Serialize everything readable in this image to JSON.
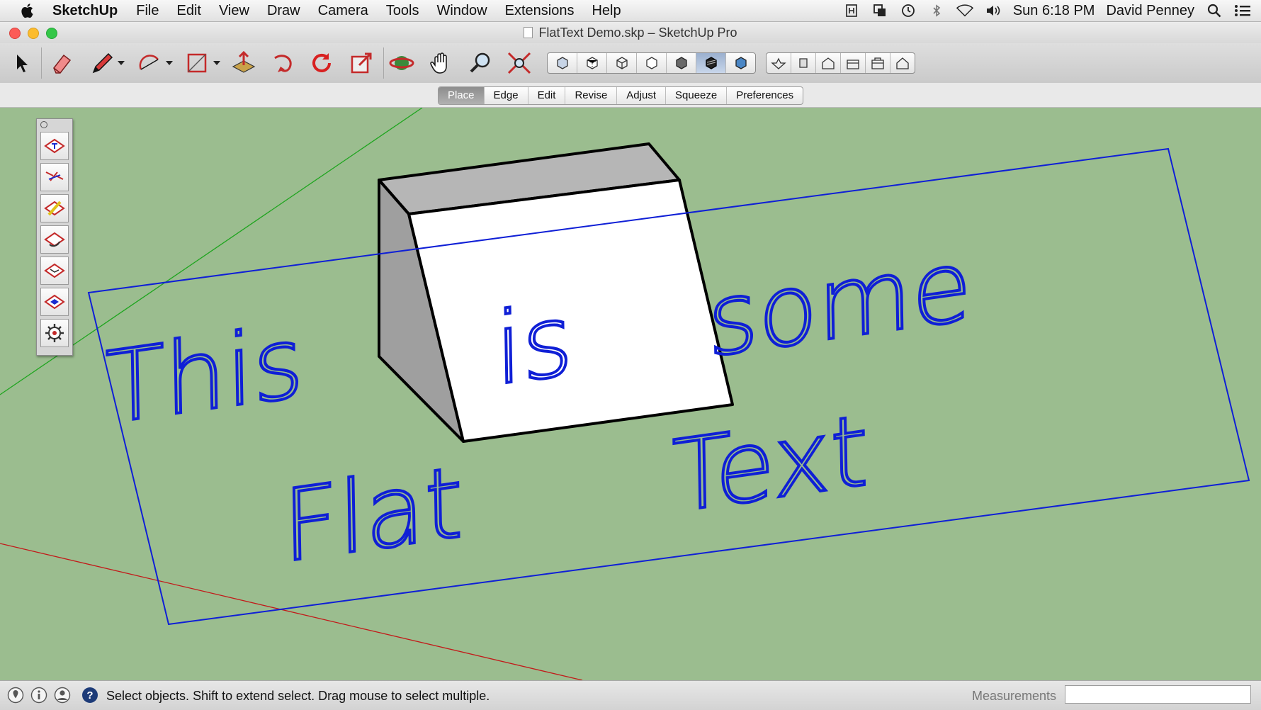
{
  "menubar": {
    "app_name": "SketchUp",
    "items": [
      "File",
      "Edit",
      "View",
      "Draw",
      "Camera",
      "Tools",
      "Window",
      "Extensions",
      "Help"
    ],
    "status_icons": [
      "scripts-icon",
      "window-overlap-icon",
      "time-machine-icon",
      "bluetooth-icon",
      "wifi-icon",
      "volume-icon"
    ],
    "clock": "Sun 6:18 PM",
    "user": "David Penney"
  },
  "window": {
    "title": "FlatText Demo.skp – SketchUp Pro"
  },
  "toolbar": {
    "tools": [
      "select-icon",
      "eraser-icon",
      "pencil-icon",
      "arc-icon",
      "rectangle-icon",
      "push-pull-icon",
      "follow-me-icon",
      "rotate-icon",
      "scale-icon",
      "orbit-icon",
      "pan-icon",
      "zoom-icon",
      "zoom-extents-icon"
    ],
    "styles_selected": "shaded",
    "style_buttons": [
      "xray-icon",
      "back-edges-icon",
      "wireframe-icon",
      "hidden-line-icon",
      "shaded-icon",
      "shaded-textures-icon",
      "monochrome-icon"
    ],
    "view_buttons": [
      "iso-view-icon",
      "top-view-icon",
      "front-view-icon",
      "right-view-icon",
      "back-view-icon",
      "left-view-icon"
    ]
  },
  "flattext_tabs": {
    "active": "Place",
    "items": [
      "Place",
      "Edge",
      "Edit",
      "Revise",
      "Adjust",
      "Squeeze",
      "Preferences"
    ]
  },
  "viewport": {
    "background_color": "#9bbd8f",
    "text_color": "#0f1fd6",
    "text_words": [
      "This",
      "is",
      "some",
      "Flat",
      "Text"
    ]
  },
  "palette": {
    "tools": [
      "place-text-icon",
      "edge-text-icon",
      "edit-text-icon",
      "revise-text-icon",
      "adjust-text-icon",
      "squeeze-text-icon",
      "preferences-gear-icon"
    ]
  },
  "statusbar": {
    "message": "Select objects. Shift to extend select. Drag mouse to select multiple.",
    "measurements_label": "Measurements",
    "measurements_value": ""
  }
}
